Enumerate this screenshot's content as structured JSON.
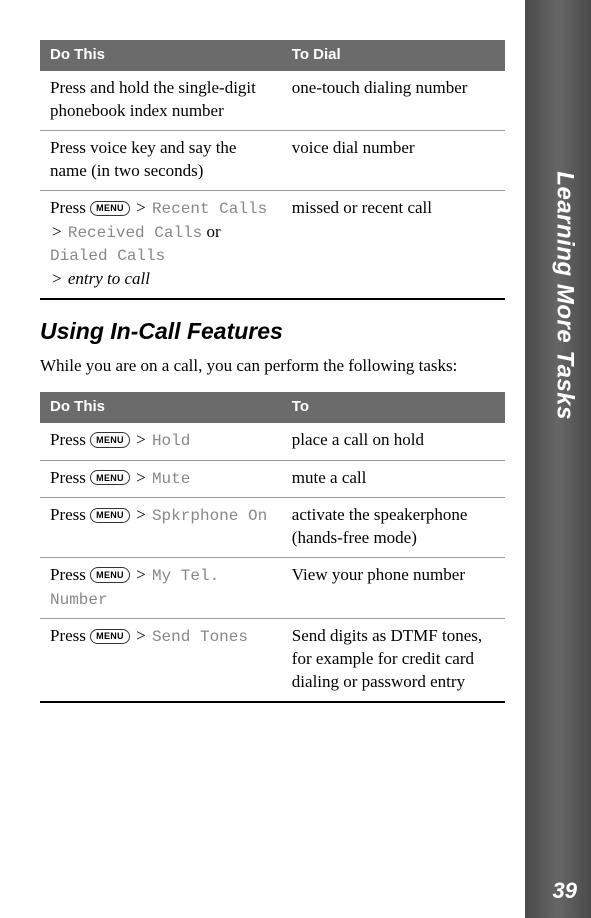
{
  "sidebar": {
    "label": "Learning More Tasks",
    "pageNumber": "39"
  },
  "table1": {
    "headerLeft": "Do This",
    "headerRight": "To Dial",
    "rows": [
      {
        "left_pre": "Press and hold the single-digit phonebook index number",
        "right": "one-touch dialing number"
      },
      {
        "left_pre": "Press voice key and say the name (in two seconds)",
        "right": "voice dial number"
      },
      {
        "row3_press": "Press ",
        "row3_menu": "MENU",
        "row3_gt1": " > ",
        "row3_recent": "Recent Calls",
        "row3_gt2": " > ",
        "row3_received": "Received Calls",
        "row3_or": " or ",
        "row3_dialed": "Dialed Calls",
        "row3_gt3": " > ",
        "row3_entry": "entry to call",
        "right": "missed or recent call"
      }
    ]
  },
  "section": {
    "title": "Using In-Call Features",
    "intro": "While you are on a call, you can perform the following tasks:"
  },
  "table2": {
    "headerLeft": "Do This",
    "headerRight": "To",
    "menuLabel": "MENU",
    "press": "Press ",
    "gt": " > ",
    "rows": [
      {
        "cmd": "Hold",
        "right": "place a call on hold"
      },
      {
        "cmd": "Mute",
        "right": "mute a call"
      },
      {
        "cmd": "Spkrphone On",
        "right": "activate the speakerphone (hands-free mode)"
      },
      {
        "cmd": "My Tel. Number",
        "right": "View your phone number"
      },
      {
        "cmd": "Send Tones",
        "right": "Send digits as DTMF tones, for example for credit card dialing or password entry"
      }
    ]
  }
}
